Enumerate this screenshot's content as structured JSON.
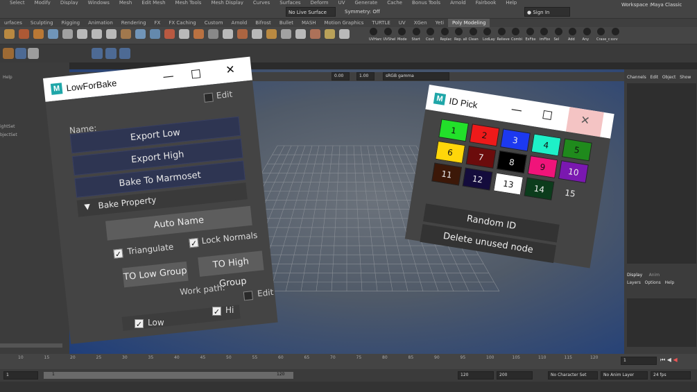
{
  "menubar": {
    "items": [
      "Select",
      "Modify",
      "Display",
      "Windows",
      "Mesh",
      "Edit Mesh",
      "Mesh Tools",
      "Mesh Display",
      "Curves",
      "Surfaces",
      "Deform",
      "UV",
      "Generate",
      "Cache",
      "Bonus Tools",
      "Arnold",
      "Fairbook",
      "Help"
    ]
  },
  "statusline": {
    "live_surface": "No Live Surface",
    "symmetry": "Symmetry: Off",
    "sign_in": "Sign In",
    "workspace_label": "Workspace :",
    "workspace_value": "Maya Classic"
  },
  "shelf_tabs": [
    "urfaces",
    "Sculpting",
    "Rigging",
    "Animation",
    "Rendering",
    "FX",
    "FX Caching",
    "Custom",
    "Arnold",
    "Bifrost",
    "Bullet",
    "MASH",
    "Motion Graphics",
    "TURTLE",
    "UV",
    "XGen",
    "Yeti",
    "Poly Modeling"
  ],
  "shelf_active": "Poly Modeling",
  "shelf_labels": [
    "UVHarc",
    "UVShel",
    "Mode",
    "Start",
    "Cout",
    "Replac",
    "Rep. all",
    "Clean",
    "LodLay",
    "Relieve",
    "Combi",
    "ExFbx",
    "imFbx",
    "Sel",
    "Add",
    "Any",
    "Crase_c",
    "ssrv"
  ],
  "left_panel": {
    "help": "Help",
    "items": [
      "ightSet",
      "bjectSet"
    ]
  },
  "viewport_toolbar": {
    "value1": "0.00",
    "value2": "1.00",
    "color_space": "sRGB gamma"
  },
  "right_panel": {
    "tabs": [
      "Channels",
      "Edit",
      "Object",
      "Show"
    ],
    "layer_tabs": [
      "Display",
      "Anim"
    ],
    "layer_menu": [
      "Layers",
      "Options",
      "Help"
    ]
  },
  "timeline": {
    "ticks": [
      "10",
      "15",
      "20",
      "25",
      "30",
      "35",
      "40",
      "45",
      "50",
      "55",
      "60",
      "65",
      "70",
      "75",
      "80",
      "85",
      "90",
      "95",
      "100",
      "105",
      "110",
      "115",
      "120"
    ],
    "current_frame": "1"
  },
  "range": {
    "start": "1",
    "inner_start": "1",
    "inner_end": "120",
    "end": "120",
    "max": "200",
    "character_set": "No Character Set",
    "anim_layer": "No Anim Layer",
    "fps": "24 fps"
  },
  "lowforbake": {
    "title": "LowForBake",
    "edit_top": "Edit",
    "name_label": "Name:",
    "export_low": "Export Low",
    "export_high": "Export High",
    "bake_to_marmoset": "Bake To Marmoset",
    "bake_property": "Bake Property",
    "auto_name": "Auto Name",
    "triangulate": "Triangulate",
    "lock_normals": "Lock Normals",
    "to_low_group": "TO Low Group",
    "to_high_group": "TO High Group",
    "work_path": "Work path:",
    "edit_bottom": "Edit",
    "low": "Low",
    "hi": "Hi"
  },
  "idpick": {
    "title": "ID Pick",
    "swatches": [
      {
        "label": "1",
        "color": "#22e02a"
      },
      {
        "label": "2",
        "color": "#ee1a1a"
      },
      {
        "label": "3",
        "color": "#1c39f0"
      },
      {
        "label": "4",
        "color": "#1ef0c8"
      },
      {
        "label": "5",
        "color": "#1f8a1c"
      },
      {
        "label": "6",
        "color": "#ffd60a"
      },
      {
        "label": "7",
        "color": "#6b0c0c"
      },
      {
        "label": "8",
        "color": "#000000"
      },
      {
        "label": "9",
        "color": "#f0147a"
      },
      {
        "label": "10",
        "color": "#7a18b0"
      },
      {
        "label": "11",
        "color": "#3c1808"
      },
      {
        "label": "12",
        "color": "#140c3c"
      },
      {
        "label": "13",
        "color": "#ffffff"
      },
      {
        "label": "14",
        "color": "#0c3c1c"
      },
      {
        "label": "15",
        "color": "#444444"
      }
    ],
    "random_id": "Random ID",
    "delete_unused": "Delete unused node"
  }
}
